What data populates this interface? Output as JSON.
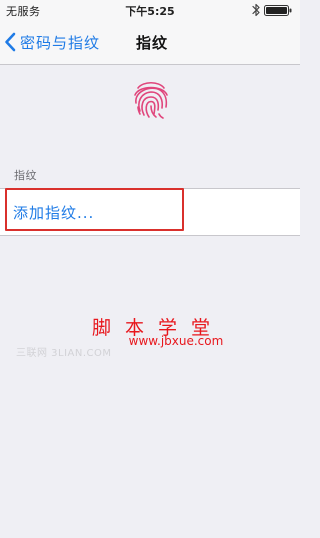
{
  "status_bar": {
    "carrier": "无服务",
    "time": "下午5:25",
    "bluetooth_icon": "bluetooth-icon",
    "battery_icon": "battery-icon"
  },
  "nav": {
    "back_label": "密码与指纹",
    "back_icon": "chevron-left-icon",
    "title": "指纹"
  },
  "fingerprint_icon": {
    "name": "fingerprint-icon",
    "color": "#e0467c"
  },
  "section": {
    "header": "指纹",
    "items": [
      {
        "label": "添加指纹..."
      }
    ]
  },
  "watermark": {
    "main": "脚 本 学 堂",
    "url": "www.jbxue.com",
    "faint": "三联网 3LIAN.COM",
    "color": "#e8171d"
  },
  "colors": {
    "accent": "#1f7be6",
    "highlight": "#d9302c",
    "background": "#efeff4"
  }
}
